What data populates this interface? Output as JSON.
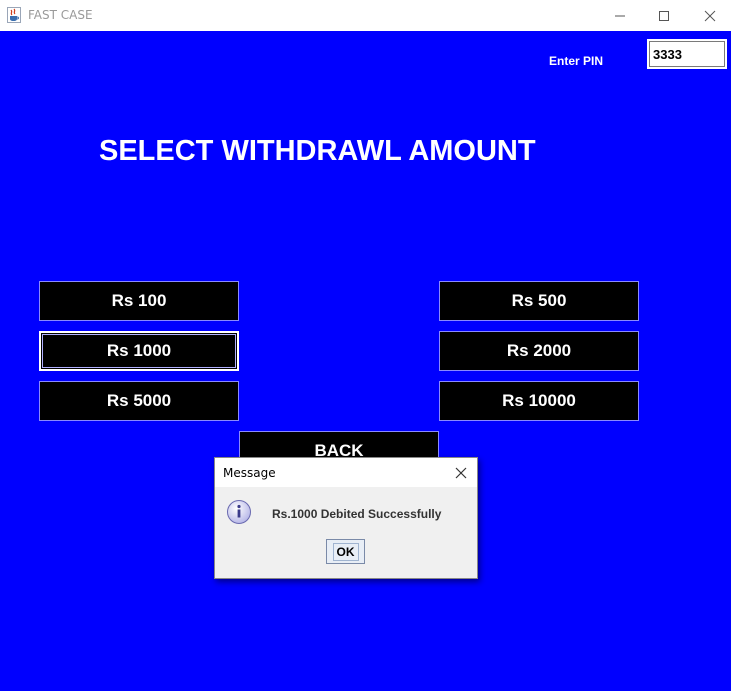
{
  "window": {
    "title": "FAST CASE",
    "app_icon": "java-cup-icon",
    "controls": [
      "minimize-icon",
      "maximize-icon",
      "close-icon"
    ]
  },
  "pin": {
    "label": "Enter PIN",
    "value": "3333"
  },
  "heading": "SELECT WITHDRAWL AMOUNT",
  "amounts": {
    "rs100": "Rs 100",
    "rs500": "Rs 500",
    "rs1000": "Rs 1000",
    "rs2000": "Rs 2000",
    "rs5000": "Rs 5000",
    "rs10000": "Rs 10000"
  },
  "back_label": "BACK",
  "dialog": {
    "title": "Message",
    "message": "Rs.1000 Debited Successfully",
    "ok_label": "OK",
    "icon": "info-icon"
  },
  "colors": {
    "background": "#0000ff",
    "button_bg": "#000000",
    "text": "#ffffff"
  }
}
